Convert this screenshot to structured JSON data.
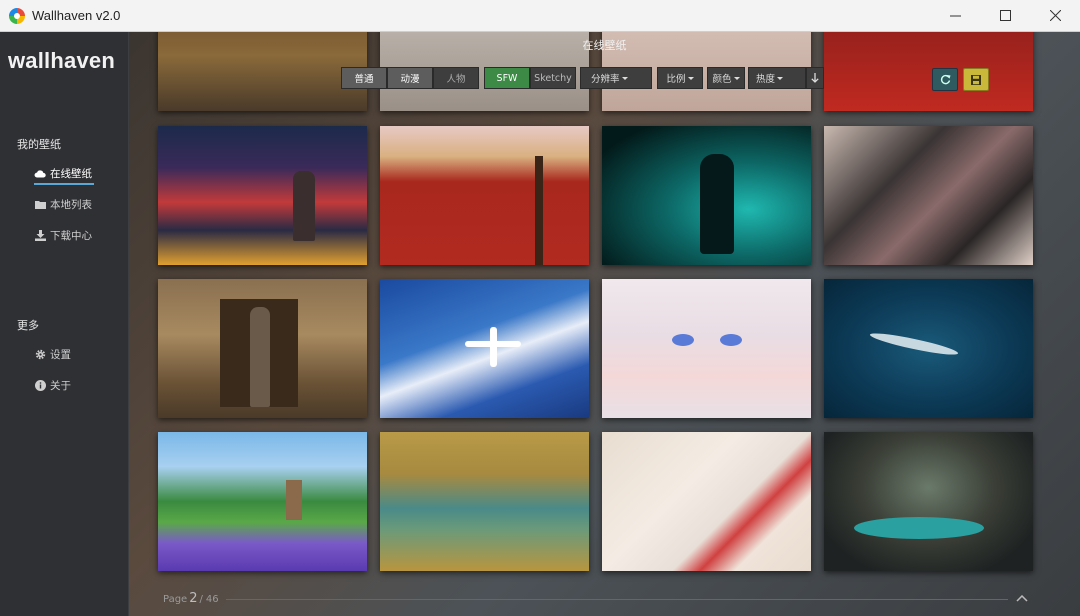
{
  "window": {
    "title": "Wallhaven v2.0"
  },
  "sidebar": {
    "logo": "wallhaven",
    "section_my": "我的壁纸",
    "items_my": [
      {
        "label": "在线壁纸",
        "icon": "cloud-icon",
        "active": true
      },
      {
        "label": "本地列表",
        "icon": "folder-icon",
        "active": false
      },
      {
        "label": "下载中心",
        "icon": "download-icon",
        "active": false
      }
    ],
    "section_more": "更多",
    "items_more": [
      {
        "label": "设置",
        "icon": "gear-icon"
      },
      {
        "label": "关于",
        "icon": "info-icon"
      }
    ]
  },
  "main": {
    "title": "在线壁纸",
    "toolbar": {
      "categories": [
        "普通",
        "动漫",
        "人物"
      ],
      "purity": [
        "SFW",
        "Sketchy"
      ],
      "resolution": "分辨率",
      "ratio": "比例",
      "color": "颜色",
      "sort": "热度",
      "order_icon": "arrow-down-icon",
      "refresh_icon": "refresh-icon",
      "save_icon": "save-icon"
    },
    "wallpapers": [
      {
        "subject": "anime city night street"
      },
      {
        "subject": "cherry blossom red wall"
      },
      {
        "subject": "spider-man teal"
      },
      {
        "subject": "boots on rug"
      },
      {
        "subject": "woman on throne"
      },
      {
        "subject": "plane above clouds"
      },
      {
        "subject": "anime white-haired girl"
      },
      {
        "subject": "whale in ocean"
      },
      {
        "subject": "windmill lavender field"
      },
      {
        "subject": "chinese landscape painting"
      },
      {
        "subject": "anime girl lying on bed"
      },
      {
        "subject": "cave lagoon"
      }
    ],
    "pager": {
      "prefix": "Page",
      "current": "2",
      "separator": "/",
      "total": "46"
    }
  },
  "colors": {
    "accent": "#5aa8d8",
    "sfw": "#3c8a45",
    "save": "#c9b83a",
    "refresh": "#2f5a5f"
  }
}
